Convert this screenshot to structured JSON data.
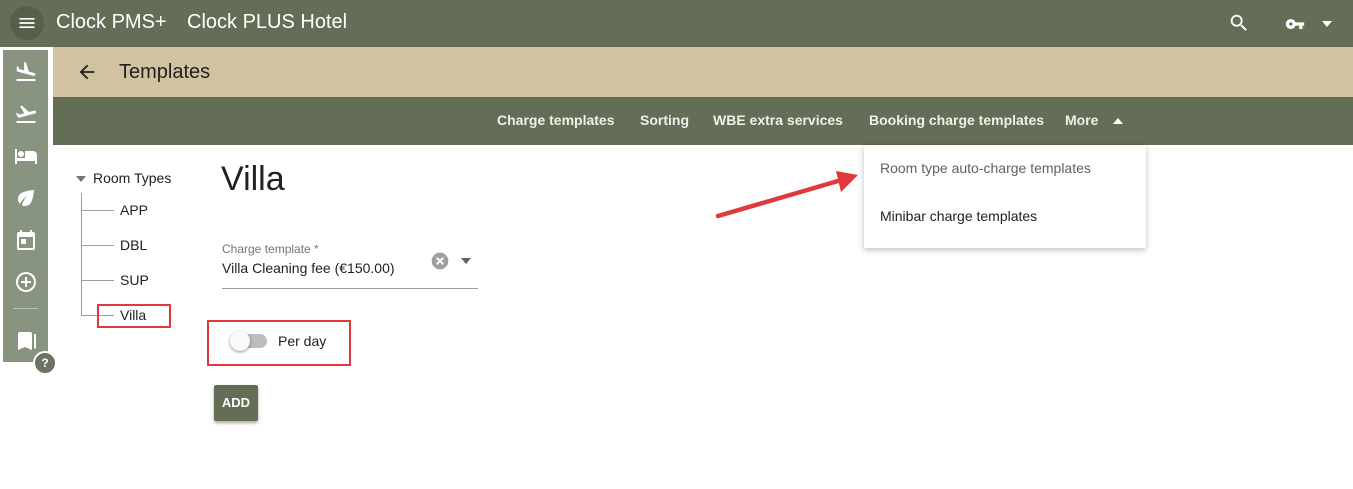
{
  "app": {
    "name": "Clock PMS+",
    "hotel": "Clock PLUS Hotel"
  },
  "header_icons": [
    "menu-icon",
    "search-icon",
    "key-icon",
    "caret-down-icon"
  ],
  "sidebar": {
    "icons": [
      "flight-land-icon",
      "flight-takeoff-icon",
      "hotel-bed-icon",
      "eco-leaf-icon",
      "calendar-icon",
      "add-circle-icon",
      "book-icon"
    ],
    "help_label": "?"
  },
  "page": {
    "title": "Templates"
  },
  "tabs": [
    {
      "label": "Charge templates"
    },
    {
      "label": "Sorting"
    },
    {
      "label": "WBE extra services"
    },
    {
      "label": "Booking charge templates"
    },
    {
      "label": "More"
    }
  ],
  "more_menu": {
    "items": [
      {
        "label": "Room type auto-charge templates"
      },
      {
        "label": "Minibar charge templates"
      }
    ]
  },
  "tree": {
    "root": "Room Types",
    "items": [
      {
        "label": "APP"
      },
      {
        "label": "DBL"
      },
      {
        "label": "SUP"
      },
      {
        "label": "Villa"
      }
    ]
  },
  "form": {
    "heading": "Villa",
    "charge_template_label": "Charge template *",
    "charge_template_value": "Villa Cleaning fee (€150.00)",
    "per_day_label": "Per day",
    "per_day_on": false,
    "add_label": "ADD"
  },
  "colors": {
    "topbar": "#646d56",
    "titlebar": "#d2c3a0",
    "sidebar": "#889380",
    "highlight": "#e0393c"
  }
}
